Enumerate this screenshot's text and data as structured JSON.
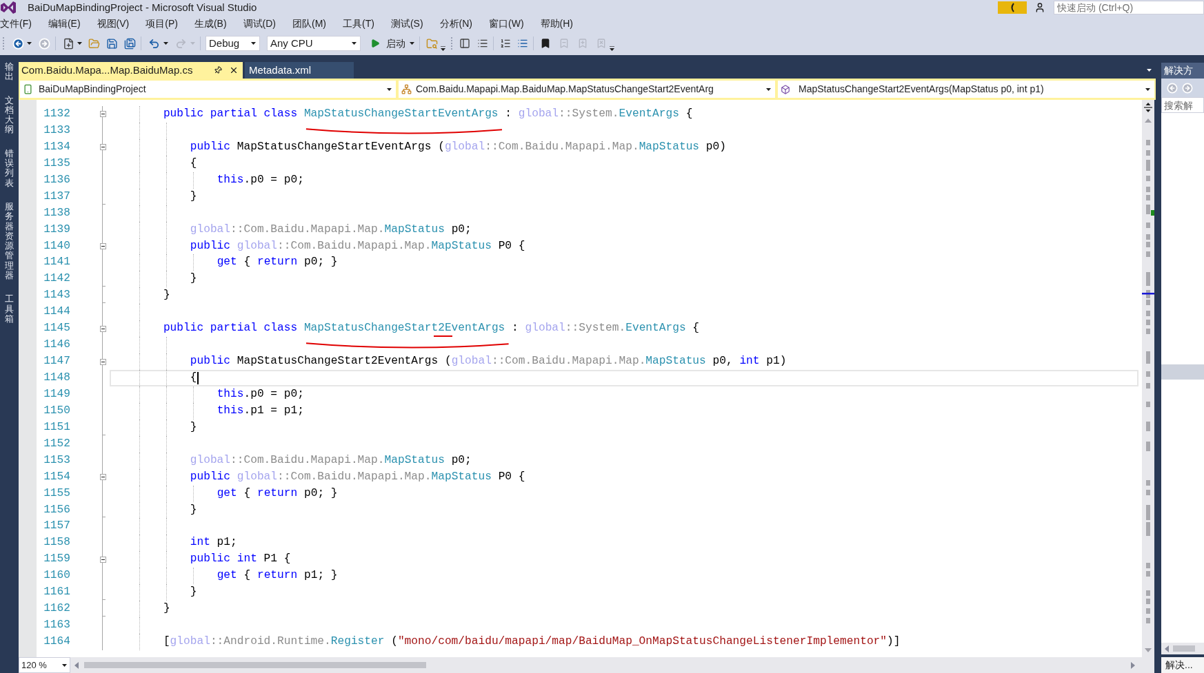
{
  "window": {
    "title": "BaiDuMapBindingProject - Microsoft Visual Studio",
    "quick_launch": {
      "placeholder": "快速启动 (Ctrl+Q)"
    }
  },
  "menu": [
    "文件(F)",
    "编辑(E)",
    "视图(V)",
    "项目(P)",
    "生成(B)",
    "调试(D)",
    "团队(M)",
    "工具(T)",
    "测试(S)",
    "分析(N)",
    "窗口(W)",
    "帮助(H)"
  ],
  "toolbar": {
    "configuration": "Debug",
    "platform": "Any CPU",
    "start": "启动"
  },
  "side_tabs": [
    "输出",
    "文档大纲",
    "错误列表",
    "服务器资源管理器",
    "工具箱"
  ],
  "editor": {
    "tabs": [
      {
        "label": "Com.Baidu.Mapa...Map.BaiduMap.cs",
        "selected": true
      },
      {
        "label": "Metadata.xml",
        "selected": false
      }
    ],
    "nav": {
      "project": "BaiDuMapBindingProject",
      "type": "Com.Baidu.Mapapi.Map.BaiduMap.MapStatusChangeStart2EventArg",
      "member": "MapStatusChangeStart2EventArgs(MapStatus p0, int p1)"
    },
    "lines": [
      {
        "number": "1132",
        "current": false,
        "fold_box": {
          "expanded": true
        },
        "tokens": [
          {
            "kind": "keyword",
            "text": "    public partial class "
          },
          {
            "kind": "type",
            "text": "MapStatusChangeStartEventArgs",
            "underlined": true
          },
          {
            "kind": "plain",
            "text": " : "
          },
          {
            "kind": "global",
            "text": "global"
          },
          {
            "kind": "qualifier",
            "text": "::System."
          },
          {
            "kind": "type",
            "text": "EventArgs"
          },
          {
            "kind": "plain",
            "text": " {"
          }
        ]
      },
      {
        "number": "1133",
        "current": false
      },
      {
        "number": "1134",
        "current": false,
        "fold_box": {
          "expanded": true
        },
        "tokens": [
          {
            "kind": "keyword",
            "text": "        public"
          },
          {
            "kind": "plain",
            "text": " MapStatusChangeStartEventArgs ("
          },
          {
            "kind": "global",
            "text": "global"
          },
          {
            "kind": "qualifier",
            "text": "::Com.Baidu.Mapapi.Map."
          },
          {
            "kind": "type",
            "text": "MapStatus"
          },
          {
            "kind": "plain",
            "text": " p0)"
          }
        ]
      },
      {
        "number": "1135",
        "current": false,
        "tokens": [
          {
            "kind": "plain",
            "text": "        {"
          }
        ]
      },
      {
        "number": "1136",
        "current": false,
        "tokens": [
          {
            "kind": "keyword",
            "text": "            this"
          },
          {
            "kind": "plain",
            "text": ".p0 = p0;"
          }
        ]
      },
      {
        "number": "1137",
        "current": false,
        "fold_end": true,
        "tokens": [
          {
            "kind": "plain",
            "text": "        }"
          }
        ]
      },
      {
        "number": "1138",
        "current": false
      },
      {
        "number": "1139",
        "current": false,
        "tokens": [
          {
            "kind": "global",
            "text": "        global"
          },
          {
            "kind": "qualifier",
            "text": "::Com.Baidu.Mapapi.Map."
          },
          {
            "kind": "type",
            "text": "MapStatus"
          },
          {
            "kind": "plain",
            "text": " p0;"
          }
        ]
      },
      {
        "number": "1140",
        "current": false,
        "fold_box": {
          "expanded": true
        },
        "tokens": [
          {
            "kind": "keyword",
            "text": "        public "
          },
          {
            "kind": "global",
            "text": "global"
          },
          {
            "kind": "qualifier",
            "text": "::Com.Baidu.Mapapi.Map."
          },
          {
            "kind": "type",
            "text": "MapStatus"
          },
          {
            "kind": "plain",
            "text": " P0 {"
          }
        ]
      },
      {
        "number": "1141",
        "current": false,
        "tokens": [
          {
            "kind": "keyword",
            "text": "            get"
          },
          {
            "kind": "plain",
            "text": " { "
          },
          {
            "kind": "keyword",
            "text": "return"
          },
          {
            "kind": "plain",
            "text": " p0; }"
          }
        ]
      },
      {
        "number": "1142",
        "current": false,
        "fold_end": true,
        "tokens": [
          {
            "kind": "plain",
            "text": "        }"
          }
        ]
      },
      {
        "number": "1143",
        "current": false,
        "fold_end": true,
        "tokens": [
          {
            "kind": "plain",
            "text": "    }"
          }
        ]
      },
      {
        "number": "1144",
        "current": false
      },
      {
        "number": "1145",
        "current": false,
        "fold_box": {
          "expanded": true
        },
        "tokens": [
          {
            "kind": "keyword",
            "text": "    public partial class "
          },
          {
            "kind": "type",
            "text": "MapStatusChangeStart",
            "underlined": true
          },
          {
            "kind": "type",
            "text": "2",
            "underlined": true,
            "double_underlined": true
          },
          {
            "kind": "type",
            "text": "EventArgs",
            "underlined": true
          },
          {
            "kind": "plain",
            "text": " : "
          },
          {
            "kind": "global",
            "text": "global"
          },
          {
            "kind": "qualifier",
            "text": "::System."
          },
          {
            "kind": "type",
            "text": "EventArgs"
          },
          {
            "kind": "plain",
            "text": " {"
          }
        ]
      },
      {
        "number": "1146",
        "current": false
      },
      {
        "number": "1147",
        "current": false,
        "fold_box": {
          "expanded": true
        },
        "tokens": [
          {
            "kind": "keyword",
            "text": "        public"
          },
          {
            "kind": "plain",
            "text": " MapStatusChangeStart2EventArgs ("
          },
          {
            "kind": "global",
            "text": "global"
          },
          {
            "kind": "qualifier",
            "text": "::Com.Baidu.Mapapi.Map."
          },
          {
            "kind": "type",
            "text": "MapStatus"
          },
          {
            "kind": "plain",
            "text": " p0, "
          },
          {
            "kind": "keyword",
            "text": "int"
          },
          {
            "kind": "plain",
            "text": " p1)"
          }
        ]
      },
      {
        "number": "1148",
        "current": true,
        "tokens": [
          {
            "kind": "plain",
            "text": "        {"
          }
        ]
      },
      {
        "number": "1149",
        "current": false,
        "tokens": [
          {
            "kind": "keyword",
            "text": "            this"
          },
          {
            "kind": "plain",
            "text": ".p0 = p0;"
          }
        ]
      },
      {
        "number": "1150",
        "current": false,
        "tokens": [
          {
            "kind": "keyword",
            "text": "            this"
          },
          {
            "kind": "plain",
            "text": ".p1 = p1;"
          }
        ]
      },
      {
        "number": "1151",
        "current": false,
        "fold_end": true,
        "tokens": [
          {
            "kind": "plain",
            "text": "        }"
          }
        ]
      },
      {
        "number": "1152",
        "current": false
      },
      {
        "number": "1153",
        "current": false,
        "tokens": [
          {
            "kind": "global",
            "text": "        global"
          },
          {
            "kind": "qualifier",
            "text": "::Com.Baidu.Mapapi.Map."
          },
          {
            "kind": "type",
            "text": "MapStatus"
          },
          {
            "kind": "plain",
            "text": " p0;"
          }
        ]
      },
      {
        "number": "1154",
        "current": false,
        "fold_box": {
          "expanded": true
        },
        "tokens": [
          {
            "kind": "keyword",
            "text": "        public "
          },
          {
            "kind": "global",
            "text": "global"
          },
          {
            "kind": "qualifier",
            "text": "::Com.Baidu.Mapapi.Map."
          },
          {
            "kind": "type",
            "text": "MapStatus"
          },
          {
            "kind": "plain",
            "text": " P0 {"
          }
        ]
      },
      {
        "number": "1155",
        "current": false,
        "tokens": [
          {
            "kind": "keyword",
            "text": "            get"
          },
          {
            "kind": "plain",
            "text": " { "
          },
          {
            "kind": "keyword",
            "text": "return"
          },
          {
            "kind": "plain",
            "text": " p0; }"
          }
        ]
      },
      {
        "number": "1156",
        "current": false,
        "fold_end": true,
        "tokens": [
          {
            "kind": "plain",
            "text": "        }"
          }
        ]
      },
      {
        "number": "1157",
        "current": false
      },
      {
        "number": "1158",
        "current": false,
        "tokens": [
          {
            "kind": "keyword",
            "text": "        int"
          },
          {
            "kind": "plain",
            "text": " p1;"
          }
        ]
      },
      {
        "number": "1159",
        "current": false,
        "fold_box": {
          "expanded": true
        },
        "tokens": [
          {
            "kind": "keyword",
            "text": "        public int"
          },
          {
            "kind": "plain",
            "text": " P1 {"
          }
        ]
      },
      {
        "number": "1160",
        "current": false,
        "tokens": [
          {
            "kind": "keyword",
            "text": "            get"
          },
          {
            "kind": "plain",
            "text": " { "
          },
          {
            "kind": "keyword",
            "text": "return"
          },
          {
            "kind": "plain",
            "text": " p1; }"
          }
        ]
      },
      {
        "number": "1161",
        "current": false,
        "fold_end": true,
        "tokens": [
          {
            "kind": "plain",
            "text": "        }"
          }
        ]
      },
      {
        "number": "1162",
        "current": false,
        "fold_end": true,
        "tokens": [
          {
            "kind": "plain",
            "text": "    }"
          }
        ]
      },
      {
        "number": "1163",
        "current": false
      },
      {
        "number": "1164",
        "current": false,
        "tokens": [
          {
            "kind": "plain",
            "text": "    ["
          },
          {
            "kind": "global",
            "text": "global"
          },
          {
            "kind": "qualifier",
            "text": "::Android.Runtime."
          },
          {
            "kind": "type",
            "text": "Register"
          },
          {
            "kind": "plain",
            "text": " ("
          },
          {
            "kind": "string",
            "text": "\"mono/com/baidu/mapapi/map/BaiduMap_OnMapStatusChangeListenerImplementor\""
          },
          {
            "kind": "plain",
            "text": ")]"
          }
        ]
      }
    ],
    "zoom": "120 %"
  },
  "solution_explorer": {
    "tab": "解决方",
    "search": {
      "placeholder": "搜索解"
    },
    "bottom_tab": "解决..."
  }
}
